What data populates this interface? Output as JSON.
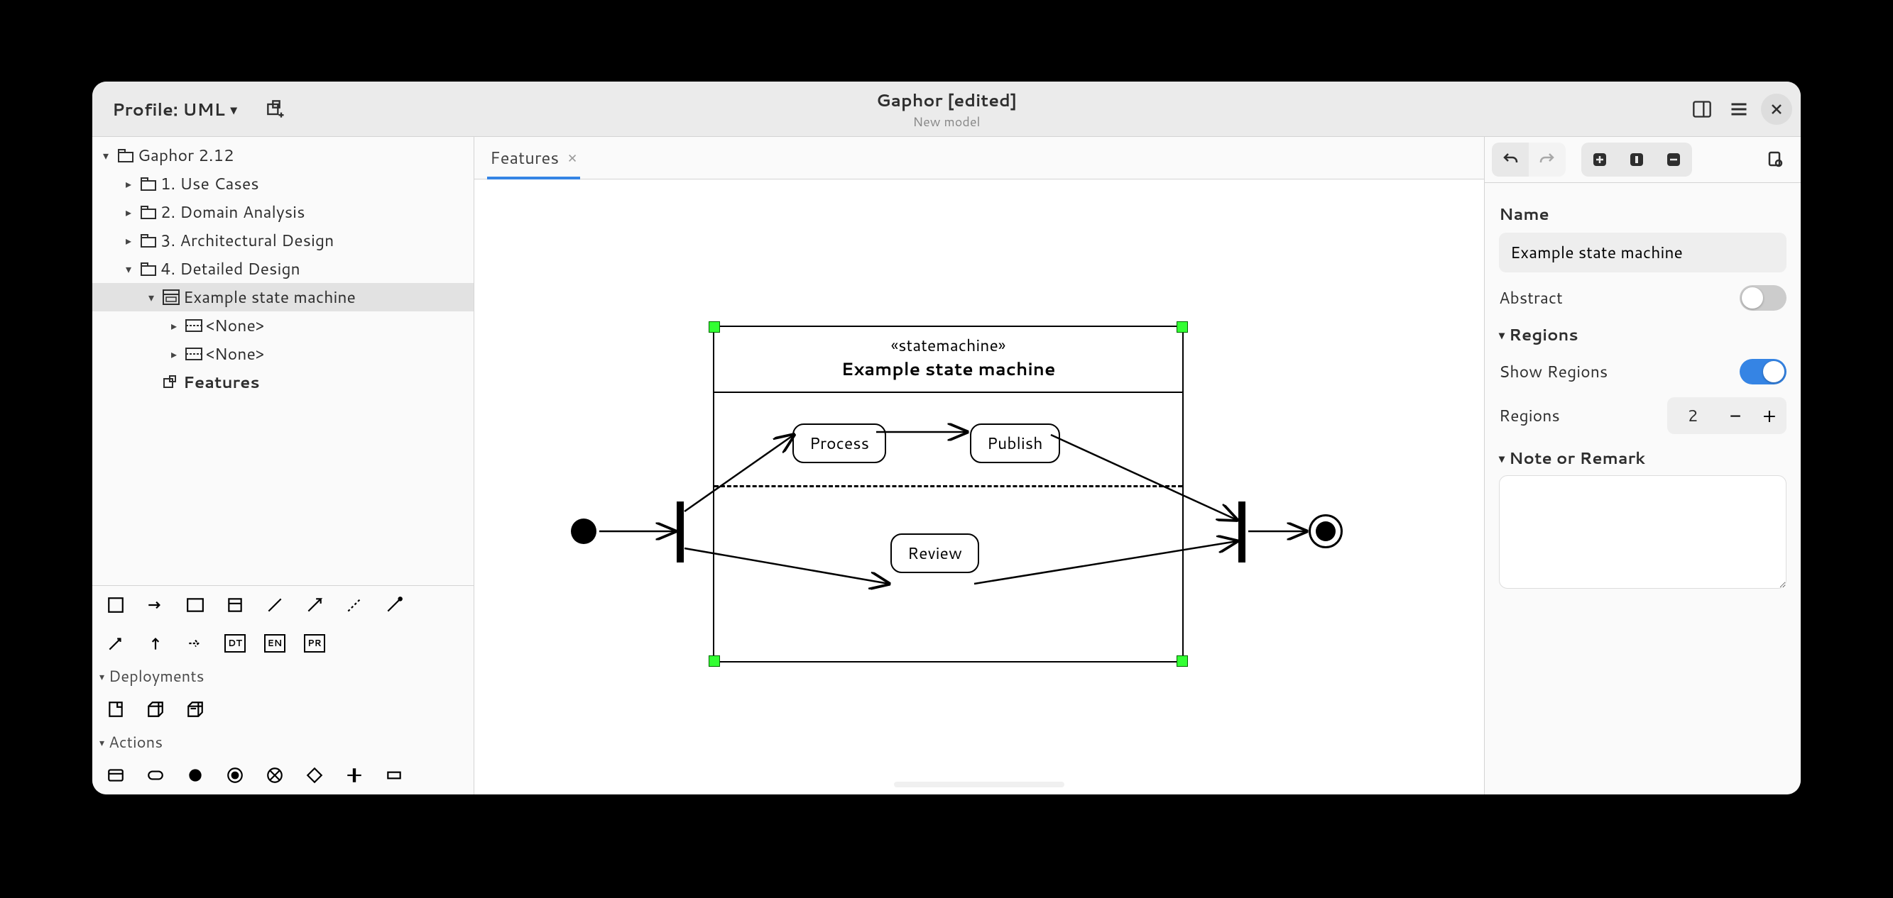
{
  "header": {
    "profile_label": "Profile: UML",
    "title": "Gaphor [edited]",
    "subtitle": "New model"
  },
  "tree": {
    "root": "Gaphor 2.12",
    "packages": [
      "1. Use Cases",
      "2. Domain Analysis",
      "3. Architectural Design",
      "4. Detailed Design"
    ],
    "state_machine": "Example state machine",
    "region_a": "<None>",
    "region_b": "<None>",
    "features": "Features"
  },
  "toolbox": {
    "section_deployments": "Deployments",
    "section_actions": "Actions",
    "badges": {
      "dt": "DT",
      "en": "EN",
      "pr": "PR"
    }
  },
  "tab": {
    "label": "Features"
  },
  "diagram": {
    "stereotype": "«statemachine»",
    "name": "Example state machine",
    "state_process": "Process",
    "state_publish": "Publish",
    "state_review": "Review"
  },
  "inspector": {
    "name_label": "Name",
    "name_value": "Example state machine",
    "abstract_label": "Abstract",
    "abstract_on": false,
    "regions_header": "Regions",
    "show_regions_label": "Show Regions",
    "show_regions_on": true,
    "regions_count_label": "Regions",
    "regions_count": "2",
    "note_header": "Note or Remark"
  }
}
